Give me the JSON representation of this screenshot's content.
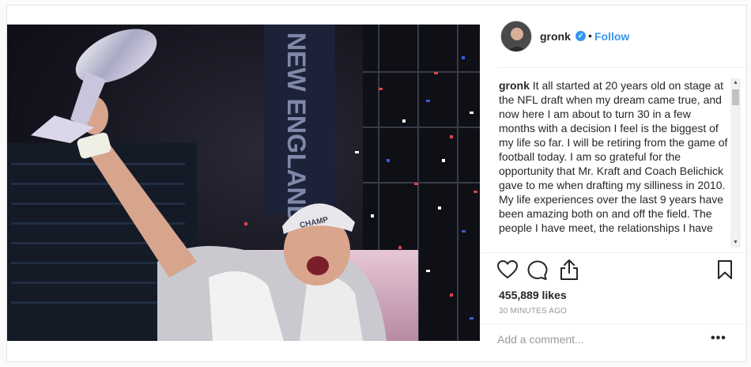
{
  "post": {
    "username": "gronk",
    "verified_icon": "verified-badge-icon",
    "separator": "•",
    "follow_label": "Follow",
    "caption_username": "gronk",
    "caption_text": "It all started at 20 years old on stage at the NFL draft when my dream came true, and now here I am about to turn 30 in a few months with a decision I feel is the biggest of my life so far. I will be retiring from the game of football today. I am so grateful for the opportunity that Mr. Kraft and Coach Belichick gave to me when drafting my silliness in 2010. My life experiences over the last 9 years have been amazing both on and off the field. The people I have meet, the relationships I have",
    "likes": "455,889 likes",
    "time": "30 MINUTES AGO",
    "comment_placeholder": "Add a comment...",
    "more_label": "•••",
    "photo_banner_text": "NEW ENGLAND PATRIOTS",
    "photo_cap_text": "CHAMP",
    "icons": {
      "like": "heart-icon",
      "comment": "comment-bubble-icon",
      "share": "share-upload-icon",
      "save": "bookmark-icon"
    },
    "colors": {
      "accent": "#3897f0",
      "text": "#262626",
      "muted": "#999999"
    }
  }
}
